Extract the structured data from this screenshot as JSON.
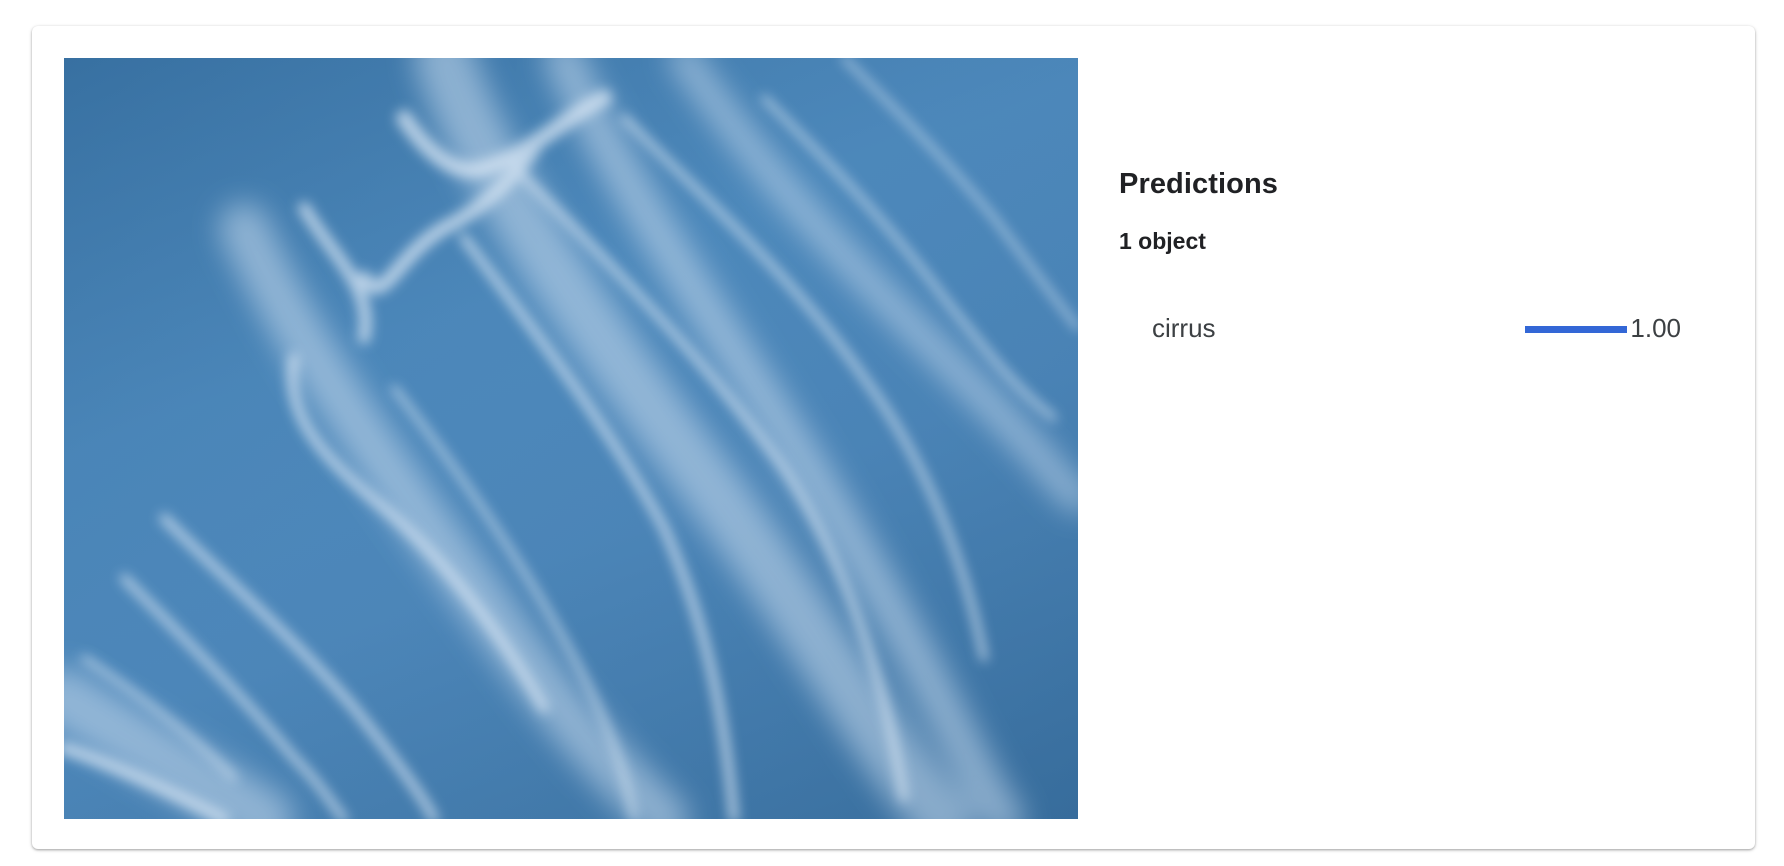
{
  "predictions": {
    "title": "Predictions",
    "count_label": "1 object",
    "items": [
      {
        "label": "cirrus",
        "score": 1.0,
        "score_text": "1.00"
      }
    ]
  },
  "colors": {
    "accent": "#3367d6",
    "sky": "#4a86b9",
    "text_primary": "#202124",
    "text_secondary": "#3c4043"
  }
}
